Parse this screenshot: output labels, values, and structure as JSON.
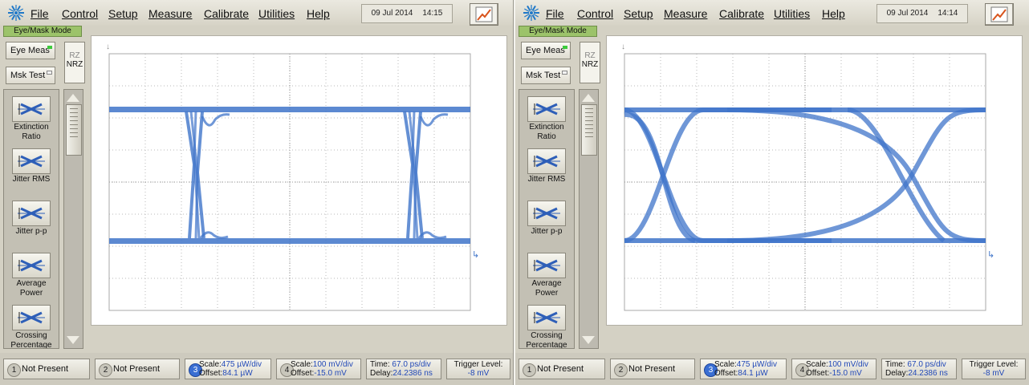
{
  "menu": [
    "File",
    "Control",
    "Setup",
    "Measure",
    "Calibrate",
    "Utilities",
    "Help"
  ],
  "mode_label": "Eye/Mask Mode",
  "buttons": {
    "eye_meas": "Eye Meas",
    "msk_test": "Msk Test",
    "rz": "RZ",
    "nrz": "NRZ"
  },
  "measurements": [
    {
      "l1": "Extinction",
      "l2": "Ratio",
      "icon": "extinction-ratio-icon"
    },
    {
      "l1": "Jitter RMS",
      "l2": "",
      "icon": "jitter-rms-icon"
    },
    {
      "l1": "Jitter p-p",
      "l2": "",
      "icon": "jitter-pp-icon"
    },
    {
      "l1": "Average",
      "l2": "Power",
      "icon": "average-power-icon"
    },
    {
      "l1": "Crossing",
      "l2": "Percentage",
      "icon": "crossing-percentage-icon"
    }
  ],
  "panels": [
    {
      "date": "09 Jul 2014",
      "time": "14:15",
      "status": {
        "ch1": {
          "num": "1",
          "text": "Not Present"
        },
        "ch2": {
          "num": "2",
          "text": "Not Present"
        },
        "ch3": {
          "num": "3",
          "scale": "Scale:",
          "scale_val": "475 µW/div",
          "offset": "Offset:",
          "offset_val": "84.1 µW"
        },
        "ch4": {
          "num": "4",
          "scale": "Scale:",
          "scale_val": "100 mV/div",
          "offset": "Offset:",
          "offset_val": "-15.0 mV"
        },
        "time": {
          "t": "Time:",
          "t_val": "67.0 ps/div",
          "d": "Delay:",
          "d_val": "24.2386 ns"
        },
        "trig": {
          "label": "Trigger Level:",
          "val": "-8 mV"
        }
      }
    },
    {
      "date": "09 Jul 2014",
      "time": "14:14",
      "status": {
        "ch1": {
          "num": "1",
          "text": "Not Present"
        },
        "ch2": {
          "num": "2",
          "text": "Not Present"
        },
        "ch3": {
          "num": "3",
          "scale": "Scale:",
          "scale_val": "475 µW/div",
          "offset": "Offset:",
          "offset_val": "84.1 µW"
        },
        "ch4": {
          "num": "4",
          "scale": "Scale:",
          "scale_val": "100 mV/div",
          "offset": "Offset:",
          "offset_val": "-15.0 mV"
        },
        "time": {
          "t": "Time:",
          "t_val": "67.0 ps/div",
          "d": "Delay:",
          "d_val": "24.2386 ns"
        },
        "trig": {
          "label": "Trigger Level:",
          "val": "-8 mV"
        }
      }
    }
  ],
  "colors": {
    "trace": "#3f74c9",
    "grid": "#b9b9b9",
    "mode_label": "#9cc36a",
    "active_channel": "#3a6fd3"
  }
}
